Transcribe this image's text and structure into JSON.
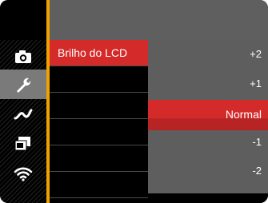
{
  "sidebar": {
    "items": [
      {
        "icon": "camera-icon"
      },
      {
        "icon": "wrench-icon",
        "active": true
      },
      {
        "icon": "connectivity-icon"
      },
      {
        "icon": "sd-card-icon"
      },
      {
        "icon": "wifi-icon"
      }
    ]
  },
  "menu": {
    "items": [
      {
        "label": "Brilho do LCD",
        "selected": true
      },
      {
        "label": ""
      },
      {
        "label": ""
      },
      {
        "label": ""
      },
      {
        "label": ""
      },
      {
        "label": ""
      }
    ]
  },
  "options": {
    "values": [
      "+2",
      "+1",
      "Normal",
      "-1",
      "-2"
    ],
    "selected": "Normal"
  },
  "colors": {
    "accent": "#d42a2a",
    "orange": "#f0a000",
    "panel": "#5e5e5e"
  }
}
